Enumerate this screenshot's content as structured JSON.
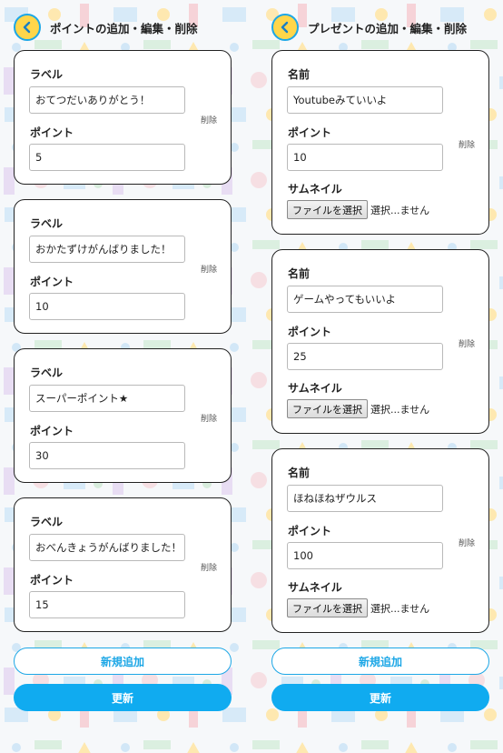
{
  "colors": {
    "accent": "#1da7e6",
    "back_button": "#ffd64a",
    "update_button": "#10abf0"
  },
  "left": {
    "title": "ポイントの追加・編集・削除",
    "back_icon": "chevron-left-icon",
    "field_label_name": "ラベル",
    "field_label_point": "ポイント",
    "delete_label": "削除",
    "items": [
      {
        "label": "おてつだいありがとう！",
        "point": "5"
      },
      {
        "label": "おかたずけがんばりました！",
        "point": "10"
      },
      {
        "label": "スーパーポイント★",
        "point": "30"
      },
      {
        "label": "おべんきょうがんばりました！",
        "point": "15"
      }
    ],
    "add_button": "新規追加",
    "update_button": "更新"
  },
  "right": {
    "title": "プレゼントの追加・編集・削除",
    "back_icon": "chevron-left-icon",
    "field_label_name": "名前",
    "field_label_point": "ポイント",
    "field_label_thumb": "サムネイル",
    "file_button": "ファイルを選択",
    "file_status": "選択...ません",
    "delete_label": "削除",
    "items": [
      {
        "name": "Youtubeみていいよ",
        "point": "10"
      },
      {
        "name": "ゲームやってもいいよ",
        "point": "25"
      },
      {
        "name": "ほねほねザウルス",
        "point": "100"
      }
    ],
    "add_button": "新規追加",
    "update_button": "更新"
  }
}
